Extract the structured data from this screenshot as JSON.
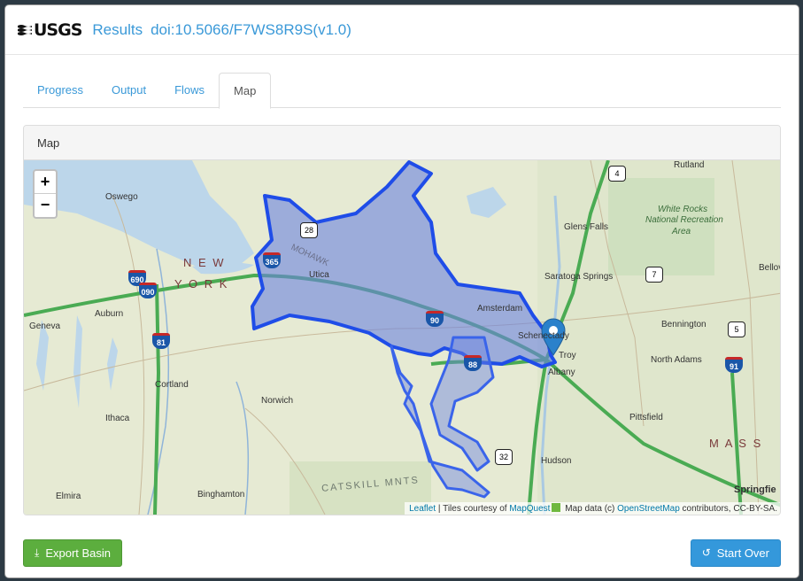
{
  "header": {
    "logo_text": "USGS",
    "title_label": "Results",
    "doi": "doi:10.5066/F7WS8R9S(v1.0)"
  },
  "tabs": [
    {
      "label": "Progress",
      "active": false
    },
    {
      "label": "Output",
      "active": false
    },
    {
      "label": "Flows",
      "active": false
    },
    {
      "label": "Map",
      "active": true
    }
  ],
  "panel": {
    "heading": "Map"
  },
  "map": {
    "zoom_in": "+",
    "zoom_out": "−",
    "attribution": {
      "leaflet": "Leaflet",
      "tiles_prefix": " | Tiles courtesy of ",
      "mapquest": "MapQuest",
      "data_prefix": " Map data (c) ",
      "osm": "OpenStreetMap",
      "suffix": " contributors, CC-BY-SA."
    },
    "labels": {
      "oswego": "Oswego",
      "new": "N E W",
      "york": "Y O R K",
      "mohawk": "MOHAWK",
      "utica": "Utica",
      "auburn": "Auburn",
      "geneva": "Geneva",
      "amsterdam": "Amsterdam",
      "schenectady": "Schenectady",
      "troy": "Troy",
      "albany": "Albany",
      "glens_falls": "Glens Falls",
      "saratoga": "Saratoga Springs",
      "rutland": "Rutland",
      "white_rocks": "White Rocks",
      "national_rec": "National Recreation",
      "area": "Area",
      "bennington": "Bennington",
      "north_adams": "North Adams",
      "pittsfield": "Pittsfield",
      "bellows": "Bellov",
      "cortland": "Cortland",
      "norwich": "Norwich",
      "ithaca": "Ithaca",
      "elmira": "Elmira",
      "binghamton": "Binghamton",
      "hudson": "Hudson",
      "catskill": "CATSKILL MNTS",
      "mass": "M A S S",
      "springfield": "Springfie"
    },
    "shields": {
      "i690": "690",
      "i090": "090",
      "i365": "365",
      "i81": "81",
      "i90": "90",
      "i88": "88",
      "i91": "91",
      "us4": "4",
      "us7": "7",
      "us5": "5",
      "s28": "28",
      "s32": "32"
    }
  },
  "footer": {
    "export_label": "Export Basin",
    "start_over_label": "Start Over"
  },
  "colors": {
    "accent": "#3a99d8",
    "basin_fill": "#6a82e0",
    "basin_stroke": "#1f4de8",
    "export_btn": "#5cae3e",
    "start_btn": "#3498db"
  }
}
